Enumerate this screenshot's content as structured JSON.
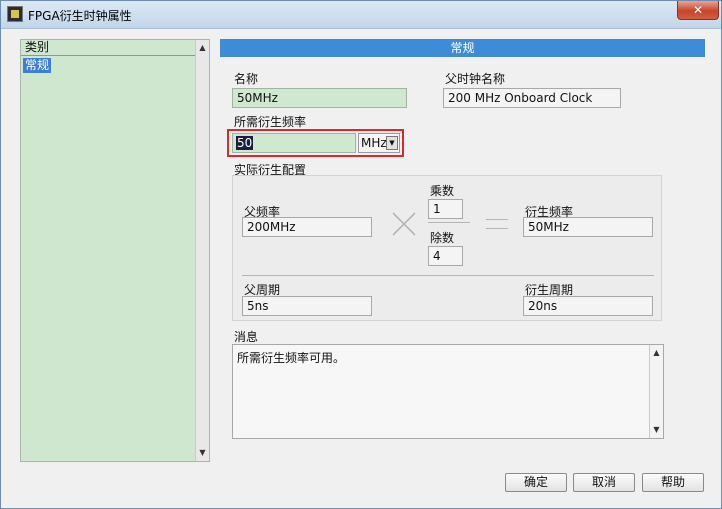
{
  "window": {
    "title": "FPGA衍生时钟属性",
    "close_label": "✕"
  },
  "category": {
    "header": "类别",
    "items": [
      {
        "label": "常规",
        "selected": true
      }
    ]
  },
  "section": {
    "title": "常规"
  },
  "name": {
    "label": "名称",
    "value": "50MHz"
  },
  "parent_clock": {
    "label": "父时钟名称",
    "value": "200 MHz Onboard Clock"
  },
  "desired_freq": {
    "label": "所需衍生频率",
    "value": "50",
    "unit": "MHz"
  },
  "actual_config": {
    "label": "实际衍生配置",
    "parent_freq": {
      "label": "父频率",
      "value": "200MHz"
    },
    "multiplier": {
      "label": "乘数",
      "value": "1"
    },
    "divisor": {
      "label": "除数",
      "value": "4"
    },
    "derived_freq": {
      "label": "衍生频率",
      "value": "50MHz"
    },
    "parent_period": {
      "label": "父周期",
      "value": "5ns"
    },
    "derived_period": {
      "label": "衍生周期",
      "value": "20ns"
    }
  },
  "message": {
    "label": "消息",
    "text": "所需衍生频率可用。"
  },
  "buttons": {
    "ok": "确定",
    "cancel": "取消",
    "help": "帮助"
  },
  "colors": {
    "accent": "#3e8bd8",
    "field_green": "#cfe8cf",
    "highlight_border": "#e02727"
  }
}
